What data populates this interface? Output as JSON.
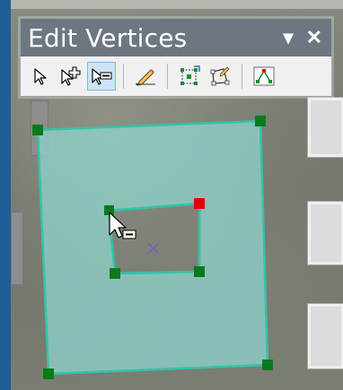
{
  "window": {
    "title": "Edit Vertices",
    "menu_icon": "dropdown-triangle-icon",
    "close_icon": "close-x-icon"
  },
  "tools": [
    {
      "name": "modify-vertex",
      "icon": "arrow-select-icon"
    },
    {
      "name": "add-vertex",
      "icon": "arrow-plus-icon"
    },
    {
      "name": "delete-vertex",
      "icon": "arrow-minus-icon",
      "active": true
    },
    {
      "name": "sketch-properties",
      "icon": "pencil-icon"
    },
    {
      "name": "reshape-feature",
      "icon": "grid-square-icon"
    },
    {
      "name": "edit-sketch",
      "icon": "polygon-edit-icon"
    },
    {
      "name": "finish-sketch",
      "icon": "vertex-triangle-icon"
    }
  ],
  "colors": {
    "polygon_fill": "#8fd8d0",
    "polygon_stroke": "#34c3a8",
    "vertex": "#0b7a1a",
    "selected_vertex": "#e50000",
    "centroid": "#6f5fc9"
  }
}
